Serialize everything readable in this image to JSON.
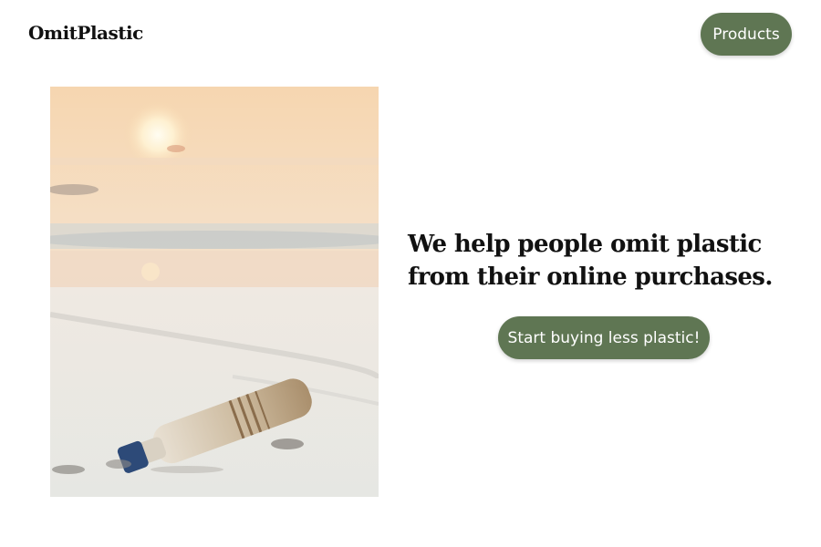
{
  "header": {
    "brand": "OmitPlastic",
    "nav_button_label": "Products"
  },
  "hero": {
    "image_icon": "beach-plastic-bottle-image",
    "headline_line1": "We help people omit plastic",
    "headline_line2": "from their online purchases.",
    "cta_label": "Start buying less plastic!"
  },
  "colors": {
    "button_bg": "#5f7653",
    "button_text": "#ffffff",
    "text": "#111111",
    "background": "#ffffff"
  }
}
